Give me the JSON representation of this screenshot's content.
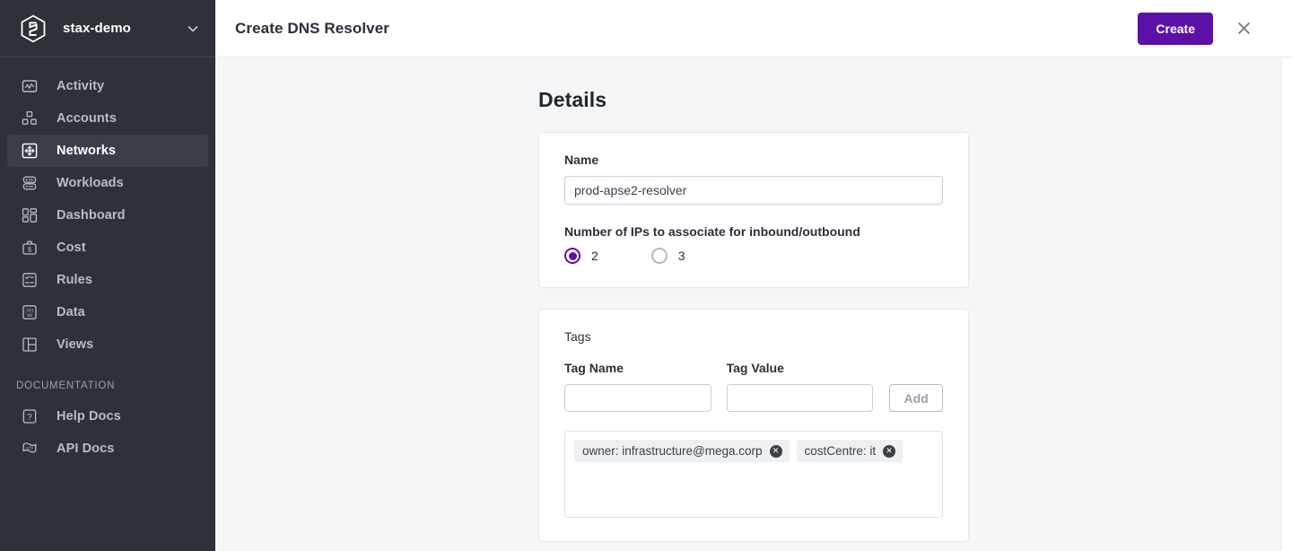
{
  "sidebar": {
    "brand": {
      "logo_icon": "stax-hexagon-logo-icon",
      "name": "stax-demo",
      "chevron_icon": "chevron-down-icon"
    },
    "items": [
      {
        "label": "Activity",
        "icon": "activity-chart-icon",
        "active": false
      },
      {
        "label": "Accounts",
        "icon": "accounts-grid-icon",
        "active": false
      },
      {
        "label": "Networks",
        "icon": "networks-move-icon",
        "active": true
      },
      {
        "label": "Workloads",
        "icon": "workloads-server-icon",
        "active": false
      },
      {
        "label": "Dashboard",
        "icon": "dashboard-layout-icon",
        "active": false
      },
      {
        "label": "Cost",
        "icon": "cost-briefcase-dollar-icon",
        "active": false
      },
      {
        "label": "Rules",
        "icon": "rules-checklist-icon",
        "active": false
      },
      {
        "label": "Data",
        "icon": "data-binary-icon",
        "active": false
      },
      {
        "label": "Views",
        "icon": "views-panel-icon",
        "active": false
      }
    ],
    "section_title": "DOCUMENTATION",
    "doc_items": [
      {
        "label": "Help Docs",
        "icon": "help-question-icon"
      },
      {
        "label": "API Docs",
        "icon": "api-code-flag-icon"
      }
    ]
  },
  "topbar": {
    "title": "Create DNS Resolver",
    "create_label": "Create",
    "close_icon": "close-x-icon"
  },
  "details": {
    "heading": "Details",
    "name_label": "Name",
    "name_value": "prod-apse2-resolver",
    "name_placeholder": "",
    "ip_count_label": "Number of IPs to associate for inbound/outbound",
    "ip_options": [
      {
        "label": "2",
        "selected": true
      },
      {
        "label": "3",
        "selected": false
      }
    ]
  },
  "tags": {
    "title": "Tags",
    "name_label": "Tag Name",
    "name_value": "",
    "name_placeholder": "",
    "value_label": "Tag Value",
    "value_value": "",
    "value_placeholder": "",
    "add_label": "Add",
    "chips": [
      {
        "text": "owner: infrastructure@mega.corp",
        "remove_icon": "remove-x-icon"
      },
      {
        "text": "costCentre: it",
        "remove_icon": "remove-x-icon"
      }
    ]
  },
  "colors": {
    "brand_purple": "#5b11a8",
    "sidebar_bg": "#2e3138",
    "sidebar_active_bg": "#3b3e46",
    "content_bg": "#f5f6f8",
    "card_border": "#e4e7eb",
    "chip_bg": "#eef0f3"
  }
}
